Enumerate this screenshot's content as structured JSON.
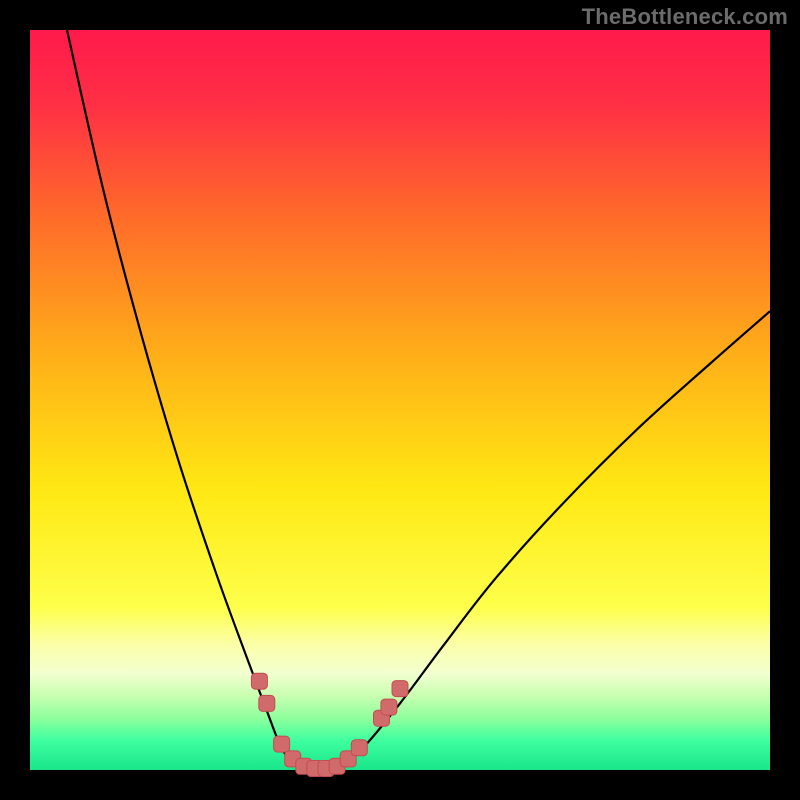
{
  "watermark": "TheBottleneck.com",
  "colors": {
    "black_border": "#000000",
    "curve": "#000000",
    "marker_fill": "#d16b6b",
    "marker_stroke": "#c24d4d"
  },
  "chart_data": {
    "type": "line",
    "title": "",
    "xlabel": "",
    "ylabel": "",
    "xlim": [
      0,
      100
    ],
    "ylim": [
      0,
      100
    ],
    "gradient_stops": [
      {
        "offset": 0.0,
        "color": "#ff1a4b"
      },
      {
        "offset": 0.1,
        "color": "#ff2f45"
      },
      {
        "offset": 0.25,
        "color": "#ff6a2a"
      },
      {
        "offset": 0.45,
        "color": "#ffb218"
      },
      {
        "offset": 0.62,
        "color": "#ffe813"
      },
      {
        "offset": 0.78,
        "color": "#fdff4a"
      },
      {
        "offset": 0.83,
        "color": "#fcffa8"
      },
      {
        "offset": 0.87,
        "color": "#f2ffd0"
      },
      {
        "offset": 0.9,
        "color": "#c7ffb0"
      },
      {
        "offset": 0.93,
        "color": "#8fff9d"
      },
      {
        "offset": 0.96,
        "color": "#3fffa0"
      },
      {
        "offset": 1.0,
        "color": "#19e58a"
      }
    ],
    "series": [
      {
        "name": "bottleneck-curve",
        "points": [
          {
            "x": 5,
            "y": 100
          },
          {
            "x": 10,
            "y": 78
          },
          {
            "x": 15,
            "y": 59
          },
          {
            "x": 20,
            "y": 42
          },
          {
            "x": 25,
            "y": 27
          },
          {
            "x": 29,
            "y": 16
          },
          {
            "x": 32,
            "y": 8
          },
          {
            "x": 34,
            "y": 3
          },
          {
            "x": 36,
            "y": 0.5
          },
          {
            "x": 38,
            "y": 0
          },
          {
            "x": 40,
            "y": 0
          },
          {
            "x": 42,
            "y": 0.5
          },
          {
            "x": 45,
            "y": 3
          },
          {
            "x": 50,
            "y": 9
          },
          {
            "x": 56,
            "y": 17
          },
          {
            "x": 63,
            "y": 26
          },
          {
            "x": 72,
            "y": 36
          },
          {
            "x": 82,
            "y": 46
          },
          {
            "x": 92,
            "y": 55
          },
          {
            "x": 100,
            "y": 62
          }
        ]
      }
    ],
    "markers": [
      {
        "x": 31.0,
        "y": 12.0
      },
      {
        "x": 32.0,
        "y": 9.0
      },
      {
        "x": 34.0,
        "y": 3.5
      },
      {
        "x": 35.5,
        "y": 1.5
      },
      {
        "x": 37.0,
        "y": 0.5
      },
      {
        "x": 38.5,
        "y": 0.2
      },
      {
        "x": 40.0,
        "y": 0.2
      },
      {
        "x": 41.5,
        "y": 0.5
      },
      {
        "x": 43.0,
        "y": 1.5
      },
      {
        "x": 44.5,
        "y": 3.0
      },
      {
        "x": 47.5,
        "y": 7.0
      },
      {
        "x": 48.5,
        "y": 8.5
      },
      {
        "x": 50.0,
        "y": 11.0
      }
    ]
  }
}
